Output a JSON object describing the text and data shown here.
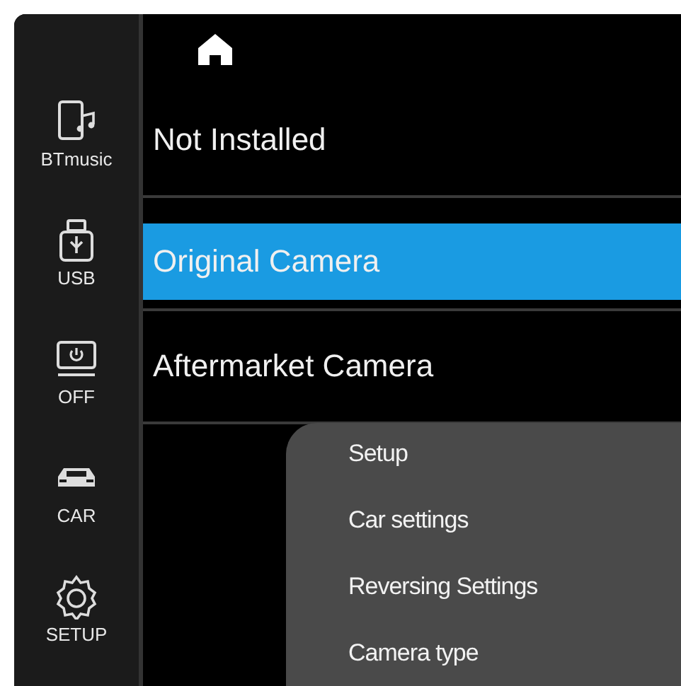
{
  "sidebar": {
    "items": [
      {
        "kind": "phone",
        "label": "BTmusic"
      },
      {
        "kind": "usb",
        "label": "USB"
      },
      {
        "kind": "screen",
        "label": "OFF"
      },
      {
        "kind": "car",
        "label": "CAR"
      },
      {
        "kind": "gear",
        "label": "SETUP"
      }
    ]
  },
  "options": [
    {
      "label": "Not Installed",
      "selected": false
    },
    {
      "label": "Original Camera",
      "selected": true
    },
    {
      "label": "Aftermarket Camera",
      "selected": false
    }
  ],
  "menu": {
    "items": [
      {
        "label": "Setup"
      },
      {
        "label": "Car settings"
      },
      {
        "label": "Reversing Settings"
      },
      {
        "label": "Camera type"
      }
    ]
  }
}
